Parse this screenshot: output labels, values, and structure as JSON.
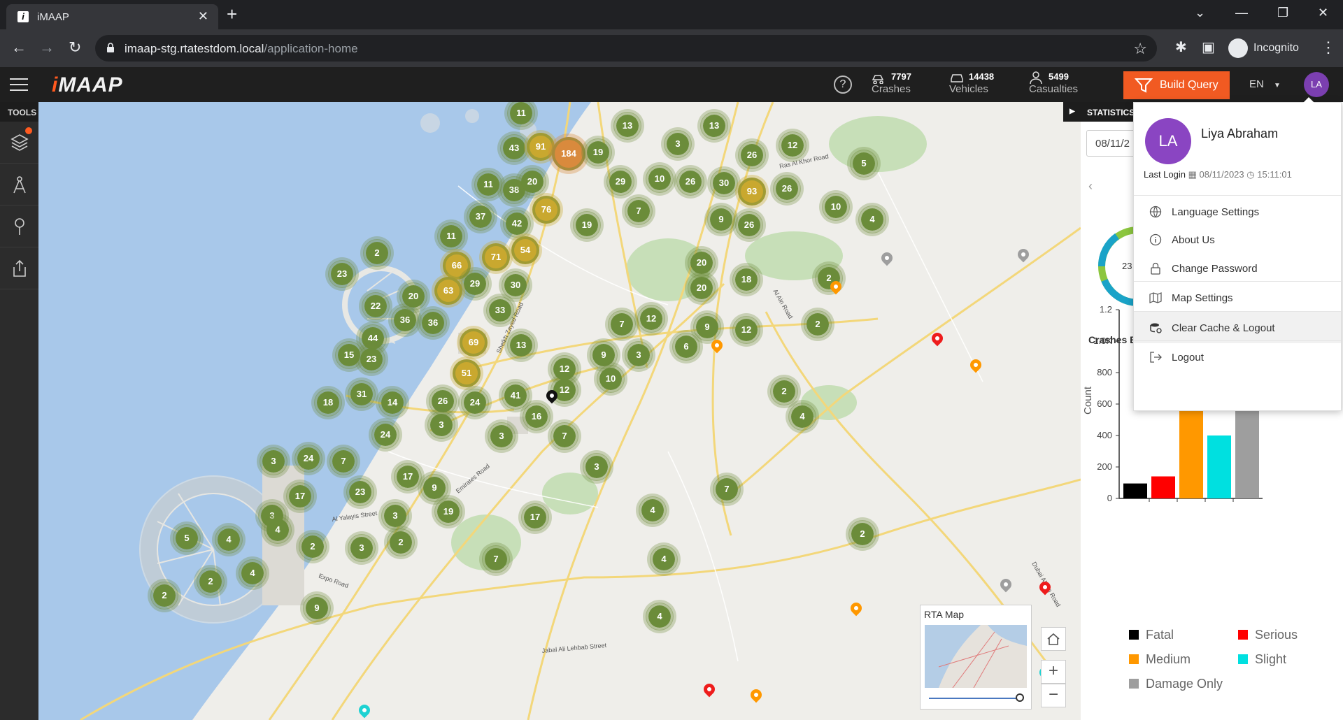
{
  "browser": {
    "tab_title": "iMAAP",
    "tab_icon": "i",
    "url_host": "imaap-stg.rtatestdom.local",
    "url_path": "/application-home",
    "profile_label": "Incognito"
  },
  "header": {
    "logo": "iMAAP",
    "stats": [
      {
        "icon": "crash-icon",
        "value": "7797",
        "label": "Crashes"
      },
      {
        "icon": "vehicle-icon",
        "value": "14438",
        "label": "Vehicles"
      },
      {
        "icon": "person-icon",
        "value": "5499",
        "label": "Casualties"
      }
    ],
    "build_query": "Build Query",
    "language": "EN",
    "avatar_initials": "LA"
  },
  "tools": {
    "label": "TOOLS"
  },
  "statistics": {
    "tab_label": "STATISTICS",
    "date_value": "08/11/2",
    "donut_value": "23",
    "section_title": "Crashes B"
  },
  "chart_data": {
    "type": "bar",
    "categories": [
      "Fatal",
      "Serious",
      "Medium",
      "Slight",
      "Damage Only"
    ],
    "values": [
      95,
      140,
      720,
      400,
      1020
    ],
    "colors": [
      "#000000",
      "#ff0000",
      "#ff9800",
      "#00e0e0",
      "#9e9e9e"
    ],
    "ylabel": "Count",
    "yticks": [
      "0",
      "200",
      "400",
      "600",
      "800",
      "1.0K",
      "1.2"
    ],
    "ylim": [
      0,
      1200
    ]
  },
  "legend": [
    {
      "label": "Fatal",
      "color": "#000000"
    },
    {
      "label": "Serious",
      "color": "#ff0000"
    },
    {
      "label": "Medium",
      "color": "#ff9800"
    },
    {
      "label": "Slight",
      "color": "#00e0e0"
    },
    {
      "label": "Damage Only",
      "color": "#9e9e9e"
    }
  ],
  "profile": {
    "initials": "LA",
    "name": "Liya Abraham",
    "last_login_label": "Last Login",
    "last_login_date": "08/11/2023",
    "last_login_time": "15:11:01",
    "menu": [
      {
        "icon": "globe-icon",
        "label": "Language Settings"
      },
      {
        "icon": "info-icon",
        "label": "About Us"
      },
      {
        "icon": "lock-icon",
        "label": "Change Password"
      },
      {
        "icon": "map-settings-icon",
        "label": "Map Settings"
      },
      {
        "icon": "clear-cache-icon",
        "label": "Clear Cache & Logout"
      },
      {
        "icon": "logout-icon",
        "label": "Logout"
      }
    ]
  },
  "map": {
    "mini_map_label": "RTA Map",
    "clusters": [
      "11",
      "43",
      "91",
      "184",
      "19",
      "13",
      "13",
      "3",
      "12",
      "26",
      "5",
      "11",
      "38",
      "20",
      "29",
      "10",
      "26",
      "30",
      "93",
      "26",
      "10",
      "4",
      "37",
      "42",
      "76",
      "7",
      "9",
      "26",
      "11",
      "71",
      "54",
      "19",
      "2",
      "66",
      "23",
      "29",
      "63",
      "30",
      "20",
      "20",
      "18",
      "2",
      "22",
      "20",
      "36",
      "36",
      "33",
      "7",
      "12",
      "9",
      "12",
      "2",
      "44",
      "69",
      "13",
      "15",
      "23",
      "51",
      "9",
      "3",
      "6",
      "10",
      "12",
      "18",
      "31",
      "14",
      "26",
      "24",
      "41",
      "12",
      "2",
      "3",
      "16",
      "24",
      "3",
      "7",
      "4",
      "3",
      "24",
      "7",
      "17",
      "3",
      "9",
      "17",
      "23",
      "19",
      "3",
      "17",
      "7",
      "4",
      "3",
      "4",
      "5",
      "4",
      "2",
      "3",
      "2",
      "7",
      "4",
      "4",
      "2",
      "2",
      "9",
      "2",
      "4"
    ],
    "road_labels": [
      "Sheikh Zayed Road",
      "Emirates Road",
      "Al Yalayis Street",
      "Expo Road",
      "Jabal Ali Lehbab Street",
      "Al Ain Road",
      "Dubai Al Ain Road",
      "Ras Al Khor Road"
    ]
  }
}
